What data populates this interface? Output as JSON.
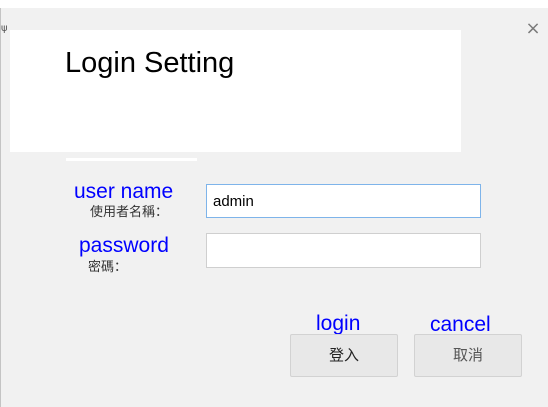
{
  "dialog": {
    "close_glyph": "×",
    "edge_glyph": "ψ",
    "title": "Login Setting"
  },
  "form": {
    "username": {
      "label_en": "user name",
      "label_zh": "使用者名稱：",
      "value": "admin"
    },
    "password": {
      "label_en": "password",
      "label_zh": "密碼：",
      "value": ""
    }
  },
  "actions": {
    "login_caption": "login",
    "login_label": "登入",
    "cancel_caption": "cancel",
    "cancel_label": "取消"
  },
  "colors": {
    "annotation": "#0000ff",
    "focused_border": "#7eb4ea"
  }
}
